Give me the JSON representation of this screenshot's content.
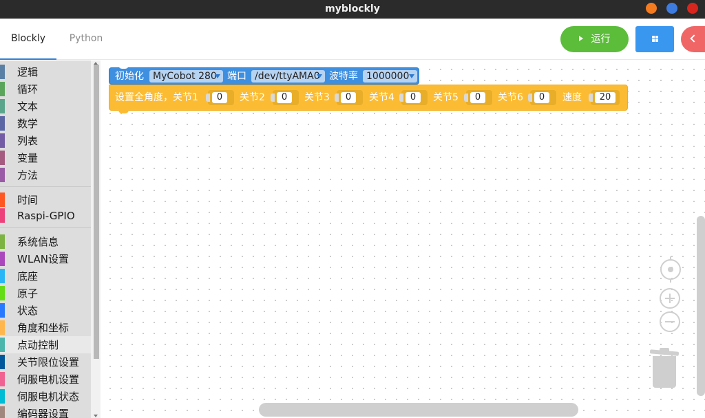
{
  "window": {
    "title": "myblockly"
  },
  "header": {
    "tabs": [
      {
        "label": "Blockly",
        "active": true
      },
      {
        "label": "Python",
        "active": false
      }
    ],
    "run_label": "运行",
    "accent_colors": {
      "run": "#5cbd3a",
      "grid": "#3a97f0",
      "back": "#f06666",
      "tab_underline": "#2f80d6"
    }
  },
  "toolbox": {
    "groups": [
      [
        {
          "label": "逻辑",
          "color": "#5b80a5"
        },
        {
          "label": "循环",
          "color": "#5ba55b"
        },
        {
          "label": "文本",
          "color": "#5ba58c"
        },
        {
          "label": "数学",
          "color": "#5b67a5"
        },
        {
          "label": "列表",
          "color": "#745ba5"
        },
        {
          "label": "变量",
          "color": "#a55b80"
        },
        {
          "label": "方法",
          "color": "#995ba5"
        }
      ],
      [
        {
          "label": "时间",
          "color": "#ff5722"
        },
        {
          "label": "Raspi-GPIO",
          "color": "#ec407a"
        }
      ],
      [
        {
          "label": "系统信息",
          "color": "#7cb342"
        },
        {
          "label": "WLAN设置",
          "color": "#ab47bc"
        },
        {
          "label": "底座",
          "color": "#29b6f6"
        },
        {
          "label": "原子",
          "color": "#64dd17"
        },
        {
          "label": "状态",
          "color": "#2979ff"
        },
        {
          "label": "角度和坐标",
          "color": "#ffb74d"
        },
        {
          "label": "点动控制",
          "color": "#4db6ac",
          "selected": true
        },
        {
          "label": "关节限位设置",
          "color": "#01579b"
        },
        {
          "label": "伺服电机设置",
          "color": "#f06292"
        },
        {
          "label": "伺服电机状态",
          "color": "#00bcd4"
        },
        {
          "label": "编码器设置",
          "color": "#a1887f"
        }
      ]
    ]
  },
  "blocks": {
    "init": {
      "label": "初始化",
      "model": "MyCobot 280",
      "port_label": "端口",
      "port": "/dev/ttyAMA0",
      "baud_label": "波特率",
      "baud": "1000000",
      "color": "#3f8fe0"
    },
    "set_angles": {
      "label": "设置全角度，关节1",
      "joint2_label": "关节2",
      "joint3_label": "关节3",
      "joint4_label": "关节4",
      "joint5_label": "关节5",
      "joint6_label": "关节6",
      "speed_label": "速度",
      "values": [
        "0",
        "0",
        "0",
        "0",
        "0",
        "0"
      ],
      "speed": "20",
      "color": "#fbbc34"
    }
  }
}
